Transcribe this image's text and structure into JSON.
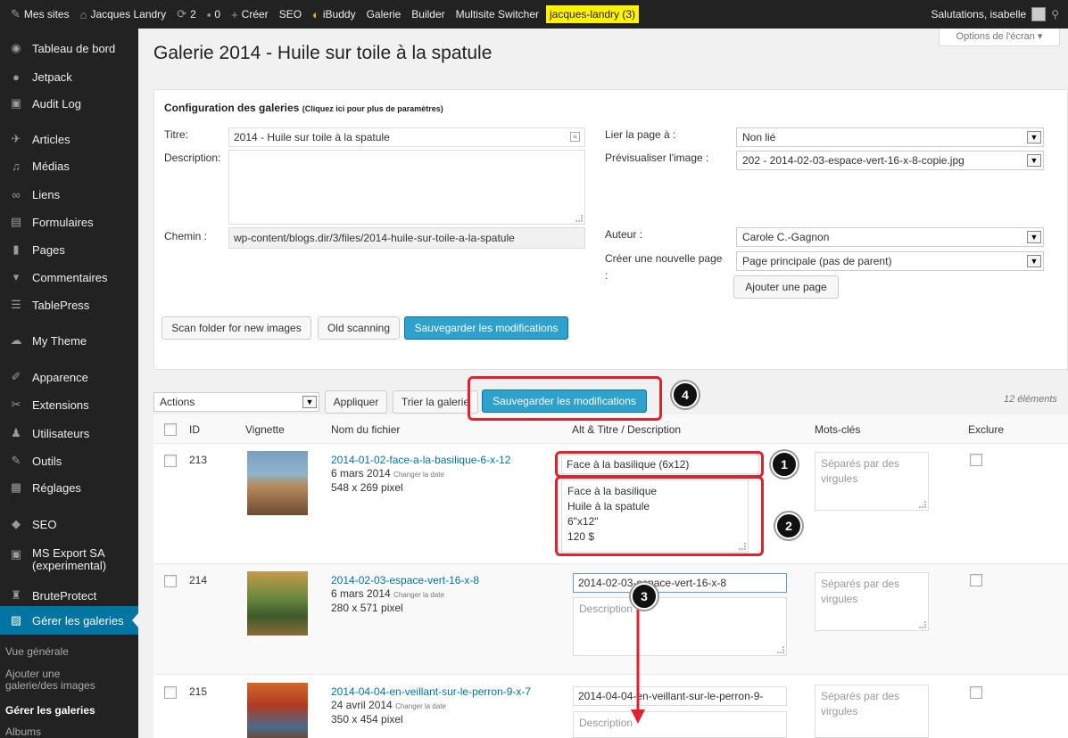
{
  "adminbar": {
    "items": [
      {
        "icon": "wordpress-icon",
        "label": "Mes sites"
      },
      {
        "icon": "home-icon",
        "label": "Jacques Landry"
      },
      {
        "icon": "updates-icon",
        "label": "2"
      },
      {
        "icon": "comments-icon",
        "label": "0"
      },
      {
        "icon": "plus-icon",
        "label": "Créer"
      },
      {
        "icon": "",
        "label": "SEO"
      },
      {
        "icon": "ibuddy-icon",
        "label": "iBuddy"
      },
      {
        "icon": "",
        "label": "Galerie"
      },
      {
        "icon": "",
        "label": "Builder"
      },
      {
        "icon": "",
        "label": "Multisite Switcher"
      }
    ],
    "highlight": "jacques-landry (3)",
    "greeting": "Salutations, isabelle"
  },
  "sidebar": {
    "items": [
      {
        "icon": "dashboard-icon",
        "label": "Tableau de bord"
      },
      {
        "icon": "jetpack-icon",
        "label": "Jetpack"
      },
      {
        "icon": "audit-log-icon",
        "label": "Audit Log"
      },
      {
        "icon": "pin-icon",
        "label": "Articles"
      },
      {
        "icon": "media-icon",
        "label": "Médias"
      },
      {
        "icon": "link-icon",
        "label": "Liens"
      },
      {
        "icon": "form-icon",
        "label": "Formulaires"
      },
      {
        "icon": "page-icon",
        "label": "Pages"
      },
      {
        "icon": "comment-icon",
        "label": "Commentaires"
      },
      {
        "icon": "table-icon",
        "label": "TablePress"
      },
      {
        "icon": "theme-icon",
        "label": "My Theme"
      },
      {
        "icon": "brush-icon",
        "label": "Apparence"
      },
      {
        "icon": "plugin-icon",
        "label": "Extensions"
      },
      {
        "icon": "users-icon",
        "label": "Utilisateurs"
      },
      {
        "icon": "wrench-icon",
        "label": "Outils"
      },
      {
        "icon": "settings-icon",
        "label": "Réglages"
      },
      {
        "icon": "seo-icon",
        "label": "SEO"
      },
      {
        "icon": "export-icon",
        "label": "MS Export SA",
        "label2": "(experimental)"
      },
      {
        "icon": "lock-icon",
        "label": "BruteProtect"
      },
      {
        "icon": "gallery-icon",
        "label": "Gérer les galeries"
      }
    ],
    "submenu": [
      "Vue générale",
      "Ajouter une",
      "galerie/des images",
      "Gérer les galeries",
      "Albums"
    ]
  },
  "screen_options": "Options de l'écran",
  "page_title": "Galerie 2014 - Huile sur toile à la spatule",
  "config": {
    "heading": "Configuration des galeries",
    "heading_small": "(Cliquez ici pour plus de paramètres)",
    "title_label": "Titre:",
    "title_value": "2014 - Huile sur toile à la spatule",
    "description_label": "Description:",
    "path_label": "Chemin :",
    "path_value": "wp-content/blogs.dir/3/files/2014-huile-sur-toile-a-la-spatule",
    "link_page_label": "Lier la page à :",
    "link_page_value": "Non lié",
    "preview_label": "Prévisualiser l'image :",
    "preview_value": "202 - 2014-02-03-espace-vert-16-x-8-copie.jpg",
    "author_label": "Auteur :",
    "author_value": "Carole C.-Gagnon",
    "new_page_label": "Créer une nouvelle page",
    "new_page_colon": ":",
    "new_page_value": "Page principale (pas de parent)",
    "add_page_button": "Ajouter une page",
    "scan_button": "Scan folder for new images",
    "old_scan_button": "Old scanning",
    "save_button": "Sauvegarder les modifications"
  },
  "list": {
    "actions_value": "Actions",
    "apply_button": "Appliquer",
    "sort_button": "Trier la galerie",
    "save_button": "Sauvegarder les modifications",
    "count": "12 éléments",
    "headers": {
      "id": "ID",
      "thumb": "Vignette",
      "file": "Nom du fichier",
      "alt": "Alt & Titre / Description",
      "tags": "Mots-clés",
      "exclude": "Exclure"
    },
    "change_date": "Changer la date",
    "tags_placeholder": "Séparés par des virgules",
    "desc_placeholder": "Description",
    "rows": [
      {
        "id": "213",
        "file": "2014-01-02-face-a-la-basilique-6-x-12",
        "date": "6 mars 2014",
        "size": "548 x 269 pixel",
        "alt": "Face à la basilique (6x12)",
        "desc": [
          "Face à la basilique",
          "Huile à la spatule",
          "6\"x12\"",
          "120 $"
        ]
      },
      {
        "id": "214",
        "file": "2014-02-03-espace-vert-16-x-8",
        "date": "6 mars 2014",
        "size": "280 x 571 pixel",
        "alt": "2014-02-03-espace-vert-16-x-8",
        "desc": []
      },
      {
        "id": "215",
        "file": "2014-04-04-en-veillant-sur-le-perron-9-x-7",
        "date": "24 avril 2014",
        "size": "350 x 454 pixel",
        "alt": "2014-04-04-en-veillant-sur-le-perron-9-",
        "desc": []
      }
    ]
  },
  "annotations": [
    "1",
    "2",
    "3",
    "4"
  ],
  "colors": {
    "adminbar": "#222222",
    "sidebar": "#222222",
    "accent": "#0074a2",
    "primary_button": "#2ea2cc",
    "highlight": "#fff200",
    "annotation": "#e0212e"
  }
}
